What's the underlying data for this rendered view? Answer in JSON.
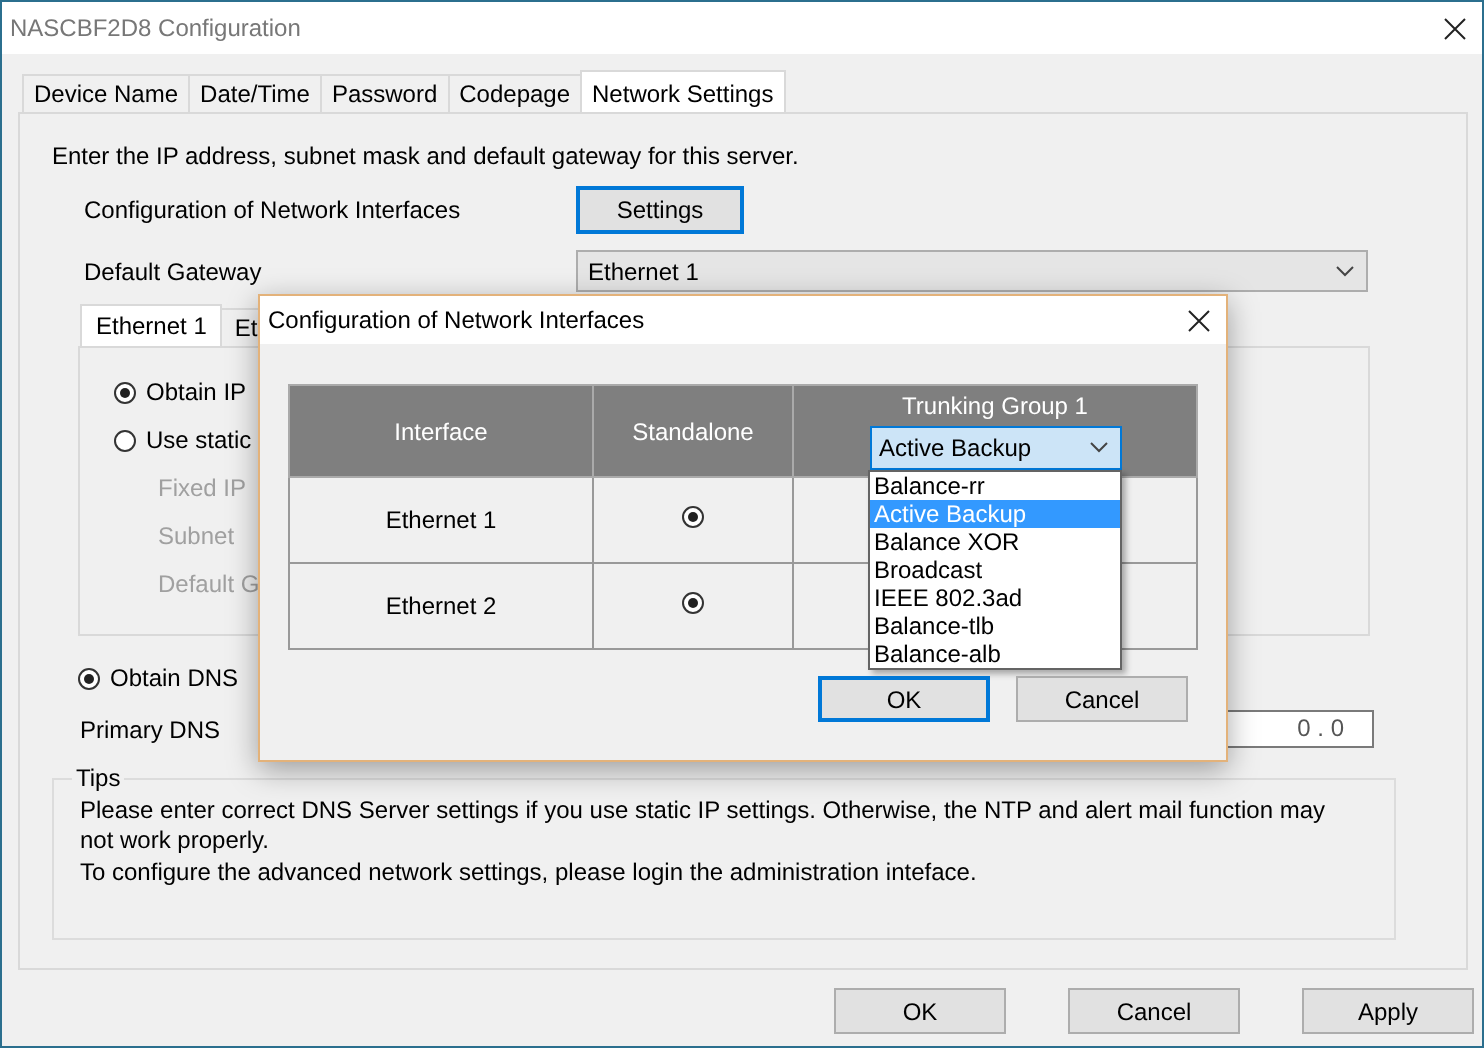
{
  "window": {
    "title": "NASCBF2D8 Configuration"
  },
  "tabs": [
    {
      "label": "Device Name",
      "selected": false
    },
    {
      "label": "Date/Time",
      "selected": false
    },
    {
      "label": "Password",
      "selected": false
    },
    {
      "label": "Codepage",
      "selected": false
    },
    {
      "label": "Network Settings",
      "selected": true
    }
  ],
  "intro": "Enter the IP address, subnet mask and default gateway for this server.",
  "network_interfaces": {
    "label": "Configuration of Network Interfaces",
    "button": "Settings"
  },
  "default_gateway": {
    "label": "Default Gateway",
    "value": "Ethernet 1"
  },
  "interface_tabs": [
    {
      "label": "Ethernet 1",
      "selected": true
    },
    {
      "label": "Et",
      "selected": false
    }
  ],
  "ip_options": [
    {
      "label": "Obtain IP",
      "selected": true
    },
    {
      "label": "Use static",
      "selected": false
    }
  ],
  "static_fields": [
    {
      "label": "Fixed IP",
      "disabled": true
    },
    {
      "label": "Subnet",
      "disabled": true
    },
    {
      "label": "Default G",
      "disabled": true
    }
  ],
  "dns": {
    "option": {
      "label": "Obtain DNS",
      "selected": true
    },
    "primary_label": "Primary DNS",
    "primary_value": "0 . 0"
  },
  "tips": {
    "title": "Tips",
    "lines": [
      "Please enter correct DNS Server settings if you use static IP settings.  Otherwise, the NTP and alert mail function may not work properly.",
      "To configure the advanced network settings, please login the administration inteface."
    ]
  },
  "buttons": [
    {
      "label": "OK"
    },
    {
      "label": "Cancel"
    },
    {
      "label": "Apply"
    }
  ],
  "dialog": {
    "title": "Configuration of Network Interfaces",
    "columns": [
      "Interface",
      "Standalone",
      "Trunking Group 1"
    ],
    "trunk_mode": "Active Backup",
    "rows": [
      {
        "interface": "Ethernet 1",
        "standalone": true
      },
      {
        "interface": "Ethernet 2",
        "standalone": true
      }
    ],
    "dropdown": [
      {
        "label": "Balance-rr",
        "selected": false
      },
      {
        "label": "Active Backup",
        "selected": true
      },
      {
        "label": "Balance XOR",
        "selected": false
      },
      {
        "label": "Broadcast",
        "selected": false
      },
      {
        "label": "IEEE 802.3ad",
        "selected": false
      },
      {
        "label": "Balance-tlb",
        "selected": false
      },
      {
        "label": "Balance-alb",
        "selected": false
      }
    ],
    "buttons": [
      {
        "label": "OK",
        "default": true
      },
      {
        "label": "Cancel",
        "default": false
      }
    ]
  }
}
